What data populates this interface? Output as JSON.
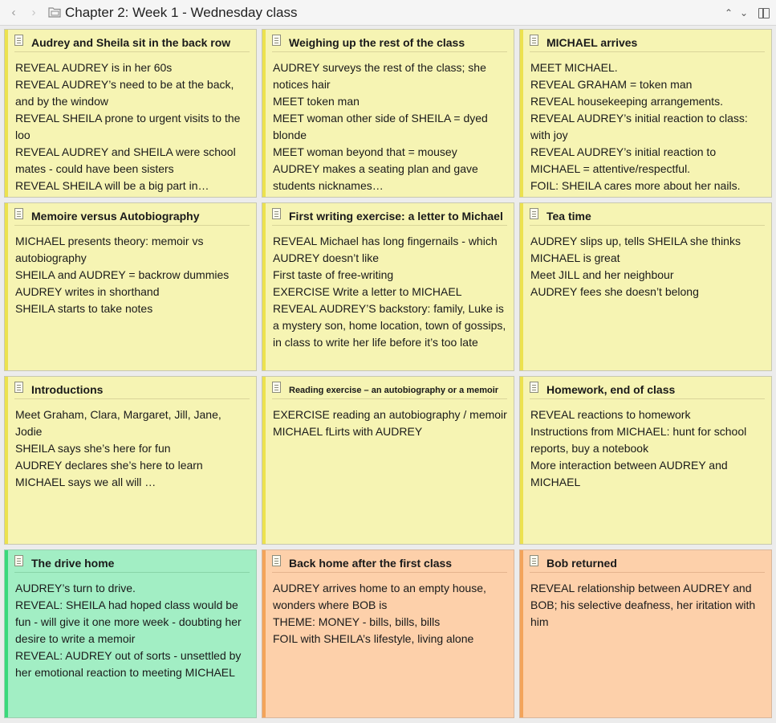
{
  "window": {
    "title": "Chapter 2: Week 1 - Wednesday class"
  },
  "cards": [
    {
      "title": "Audrey and Sheila sit in the back row",
      "color": "yellow",
      "lines": [
        "REVEAL AUDREY is in her 60s",
        "REVEAL AUDREY’s need to be at the back, and by the window",
        "REVEAL SHEILA prone to urgent visits to the loo",
        "REVEAL AUDREY and SHEILA were school mates - could have been sisters",
        "REVEAL SHEILA will be a big part in…"
      ]
    },
    {
      "title": "Weighing up the rest of the class",
      "color": "yellow",
      "lines": [
        "AUDREY surveys the rest of the class; she notices hair",
        "MEET token man",
        "MEET woman other side of SHEILA = dyed blonde",
        "MEET woman beyond that = mousey",
        "AUDREY makes a seating plan and gave students nicknames…"
      ]
    },
    {
      "title": "MICHAEL arrives",
      "color": "yellow",
      "lines": [
        "MEET MICHAEL.",
        "REVEAL GRAHAM = token man",
        "REVEAL housekeeping arrangements.",
        "REVEAL AUDREY’s initial reaction to class: with joy",
        "REVEAL AUDREY’s initial reaction to MICHAEL = attentive/respectful.",
        "FOIL: SHEILA cares more about her nails."
      ]
    },
    {
      "title": "Memoire versus Autobiography",
      "color": "yellow",
      "lines": [
        "MICHAEL presents theory: memoir vs autobiography",
        "SHEILA and AUDREY = backrow dummies",
        "AUDREY writes in shorthand",
        "SHEILA starts to take notes"
      ]
    },
    {
      "title": "First writing exercise: a letter to Michael",
      "color": "yellow",
      "lines": [
        "REVEAL Michael has long fingernails - which AUDREY doesn’t like",
        "First taste of free-writing",
        "EXERCISE Write a letter to MICHAEL",
        "REVEAL AUDREY’S backstory: family, Luke is a mystery son, home location, town of gossips, in class to write her life before it’s too late"
      ]
    },
    {
      "title": "Tea time",
      "color": "yellow",
      "lines": [
        "AUDREY slips up, tells SHEILA she thinks MICHAEL is great",
        "Meet JILL and her neighbour",
        "AUDREY fees she doesn’t belong"
      ]
    },
    {
      "title": "Introductions",
      "color": "yellow",
      "lines": [
        "Meet Graham, Clara, Margaret, Jill, Jane, Jodie",
        "SHEILA says she’s here for fun",
        "AUDREY declares she’s here to learn",
        "MICHAEL says we all will …"
      ]
    },
    {
      "title": "Reading exercise – an autobiography or a memoir",
      "color": "yellow",
      "small": true,
      "lines": [
        "EXERCISE reading an autobiography / memoir",
        "MICHAEL fLirts with AUDREY"
      ]
    },
    {
      "title": "Homework, end of class",
      "color": "yellow",
      "lines": [
        "REVEAL reactions to homework",
        "Instructions from MICHAEL: hunt for school reports, buy a notebook",
        "More interaction between AUDREY and MICHAEL"
      ]
    },
    {
      "title": "The drive home",
      "color": "green",
      "lines": [
        "AUDREY’s turn to drive.",
        "REVEAL: SHEILA had hoped class would be fun - will give it one more week - doubting her desire to write a memoir",
        "REVEAL: AUDREY out of sorts - unsettled by her emotional reaction to meeting MICHAEL"
      ]
    },
    {
      "title": "Back home after the first class",
      "color": "orange",
      "lines": [
        "AUDREY arrives home to an empty house, wonders where BOB is",
        "THEME: MONEY - bills, bills, bills",
        "FOIL with SHEILA’s lifestyle, living alone"
      ]
    },
    {
      "title": "Bob returned",
      "color": "orange",
      "lines": [
        "REVEAL relationship between AUDREY and BOB; his selective deafness, her iritation with him"
      ]
    }
  ]
}
